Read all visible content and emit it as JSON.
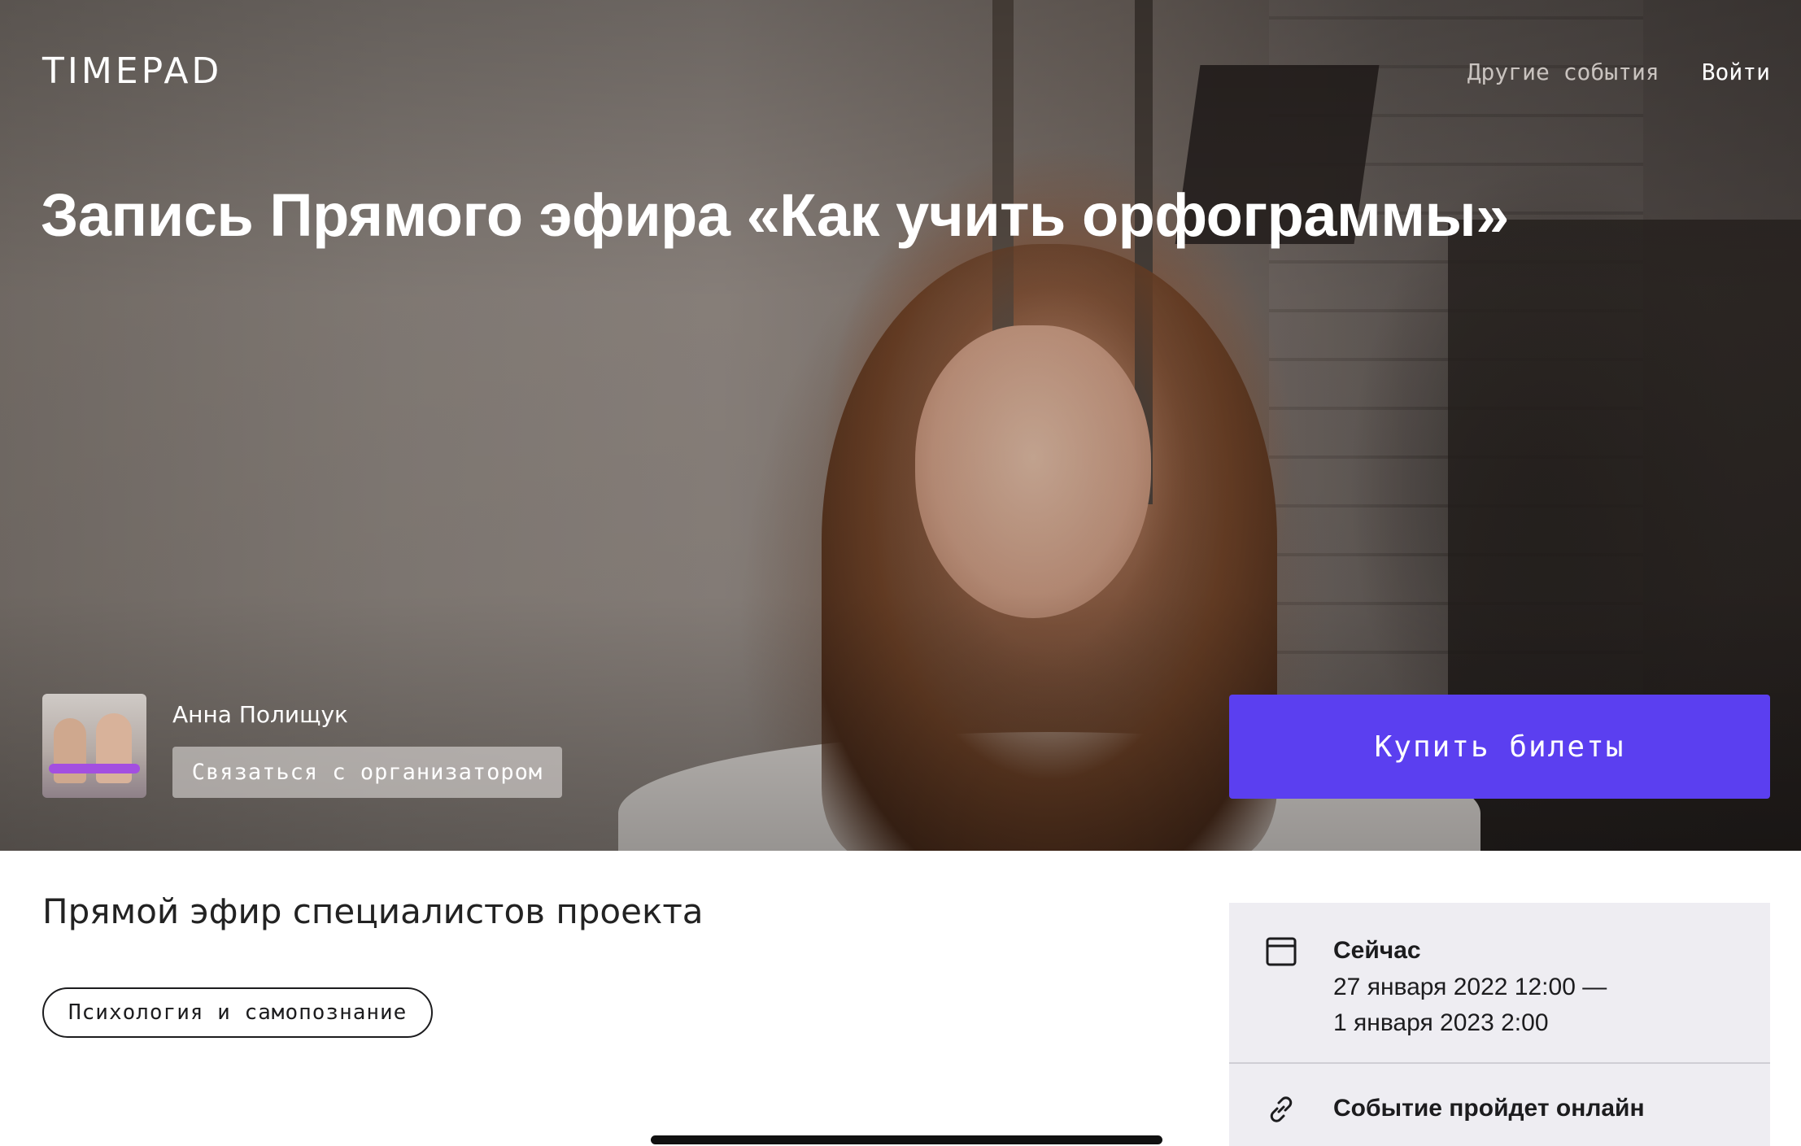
{
  "header": {
    "logo": "TIMEPAD",
    "nav": {
      "other_events": "Другие события",
      "login": "Войти"
    }
  },
  "event": {
    "title": "Запись Прямого эфира «Как учить орфограммы»",
    "subtitle": "Прямой эфир специалистов проекта",
    "tag": "Психология и самопознание"
  },
  "organizer": {
    "name": "Анна Полищук",
    "contact_label": "Связаться с организатором"
  },
  "purchase": {
    "buy_label": "Купить билеты"
  },
  "info": {
    "date_heading": "Сейчас",
    "date_line1": "27 января 2022 12:00 —",
    "date_line2": "1 января 2023 2:00",
    "online_text": "Событие пройдет онлайн",
    "date_icon": "calendar-icon",
    "online_icon": "link-icon"
  },
  "colors": {
    "accent": "#5b3ff0",
    "card_bg": "#eeedf2"
  }
}
